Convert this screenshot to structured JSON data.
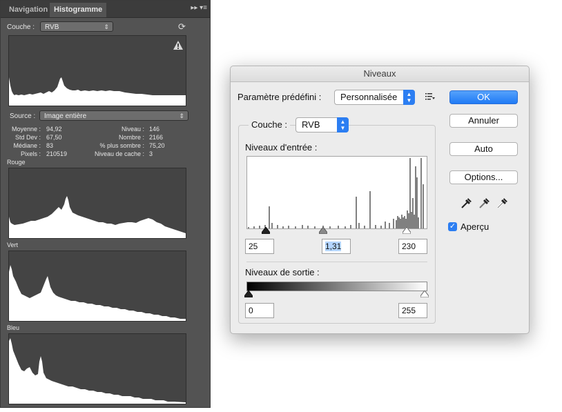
{
  "panel": {
    "tabs": [
      "Navigation",
      "Histogramme"
    ],
    "tab_icons": "▸▸  ▾≡",
    "couche_label": "Couche :",
    "couche_value": "RVB",
    "source_label": "Source :",
    "source_value": "Image entière",
    "stats": {
      "moyenne_label": "Moyenne :",
      "moyenne": "94,92",
      "stddev_label": "Std Dev :",
      "stddev": "67,50",
      "mediane_label": "Médiane :",
      "mediane": "83",
      "pixels_label": "Pixels :",
      "pixels": "210519",
      "niveau_label": "Niveau :",
      "niveau": "146",
      "nombre_label": "Nombre :",
      "nombre": "2166",
      "plus_sombre_label": "% plus sombre :",
      "plus_sombre": "75,20",
      "cache_label": "Niveau de cache :",
      "cache": "3"
    },
    "channels": [
      "Rouge",
      "Vert",
      "Bleu"
    ]
  },
  "dialog": {
    "title": "Niveaux",
    "preset_label": "Paramètre prédéfini :",
    "preset_value": "Personnalisée",
    "couche_label": "Couche :",
    "couche_value": "RVB",
    "input_levels_label": "Niveaux d'entrée :",
    "input_black": "25",
    "input_gamma": "1,31",
    "input_white": "230",
    "output_levels_label": "Niveaux de sortie :",
    "output_black": "0",
    "output_white": "255",
    "buttons": {
      "ok": "OK",
      "cancel": "Annuler",
      "auto": "Auto",
      "options": "Options..."
    },
    "preview_label": "Aperçu",
    "preview_checked": true
  },
  "colors": {
    "accent": "#2c7ef2",
    "panel_bg": "#535353",
    "dialog_bg": "#ececec"
  }
}
